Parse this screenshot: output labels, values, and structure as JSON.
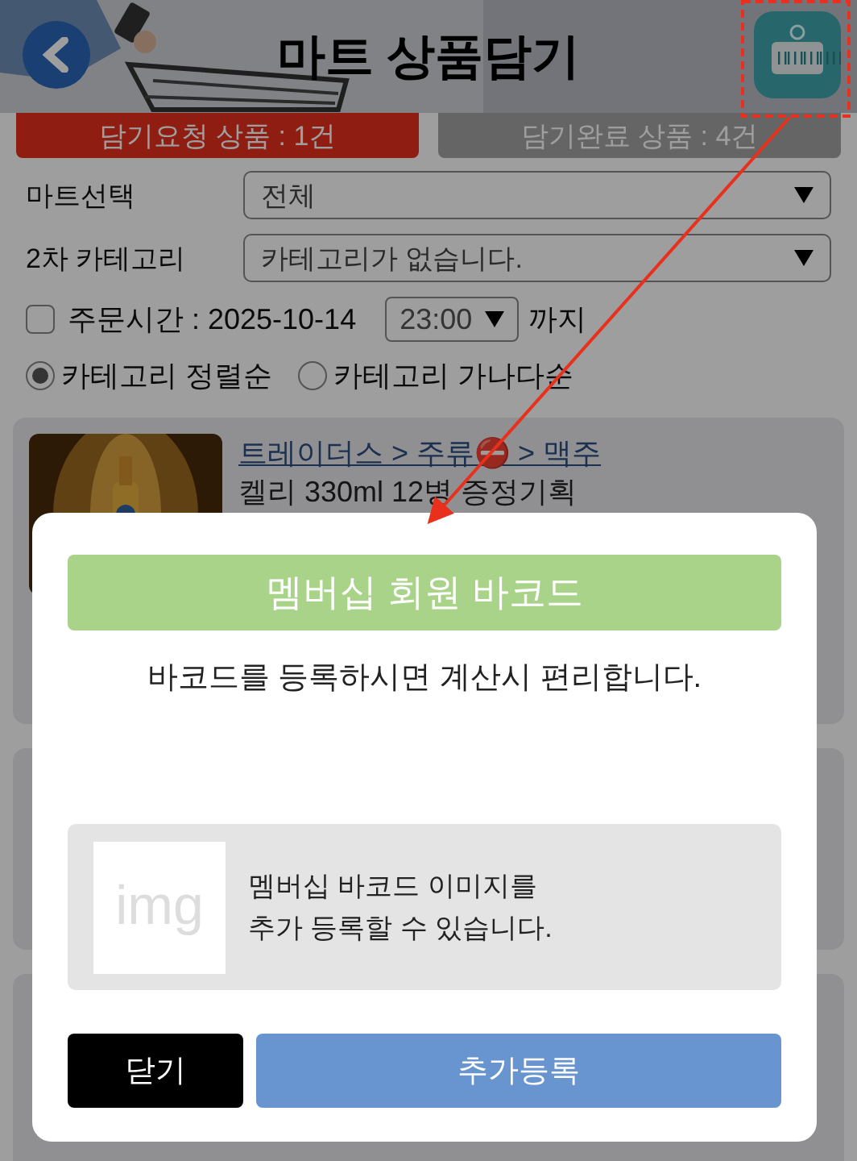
{
  "header": {
    "title": "마트 상품담기"
  },
  "tabs": [
    {
      "label": "담기요청 상품 : 1건",
      "selected": true
    },
    {
      "label": "담기완료 상품 : 4건",
      "selected": false
    }
  ],
  "filters": [
    {
      "label": "마트선택",
      "value": "전체"
    },
    {
      "label": "2차 카테고리",
      "value": "카테고리가 없습니다."
    }
  ],
  "order_time": {
    "checked": false,
    "label": "주문시간 : 2025-10-14",
    "time": "23:00",
    "suffix": "까지"
  },
  "sort_options": [
    {
      "label": "카테고리 정렬순",
      "selected": true
    },
    {
      "label": "카테고리 가나다순",
      "selected": false
    }
  ],
  "products": [
    {
      "breadcrumb": "트레이더스 > 주류⛔ > 맥주",
      "name": "켈리 330ml 12병 증정기획"
    }
  ],
  "modal": {
    "title": "멤버십 회원 바코드",
    "message": "바코드를 등록하시면 계산시 편리합니다.",
    "image_placeholder": "img",
    "hint_lines": [
      "멤버십 바코드 이미지를",
      "추가 등록할 수 있습니다."
    ],
    "buttons": [
      {
        "label": "닫기",
        "kind": "close"
      },
      {
        "label": "추가등록",
        "kind": "primary"
      }
    ]
  }
}
